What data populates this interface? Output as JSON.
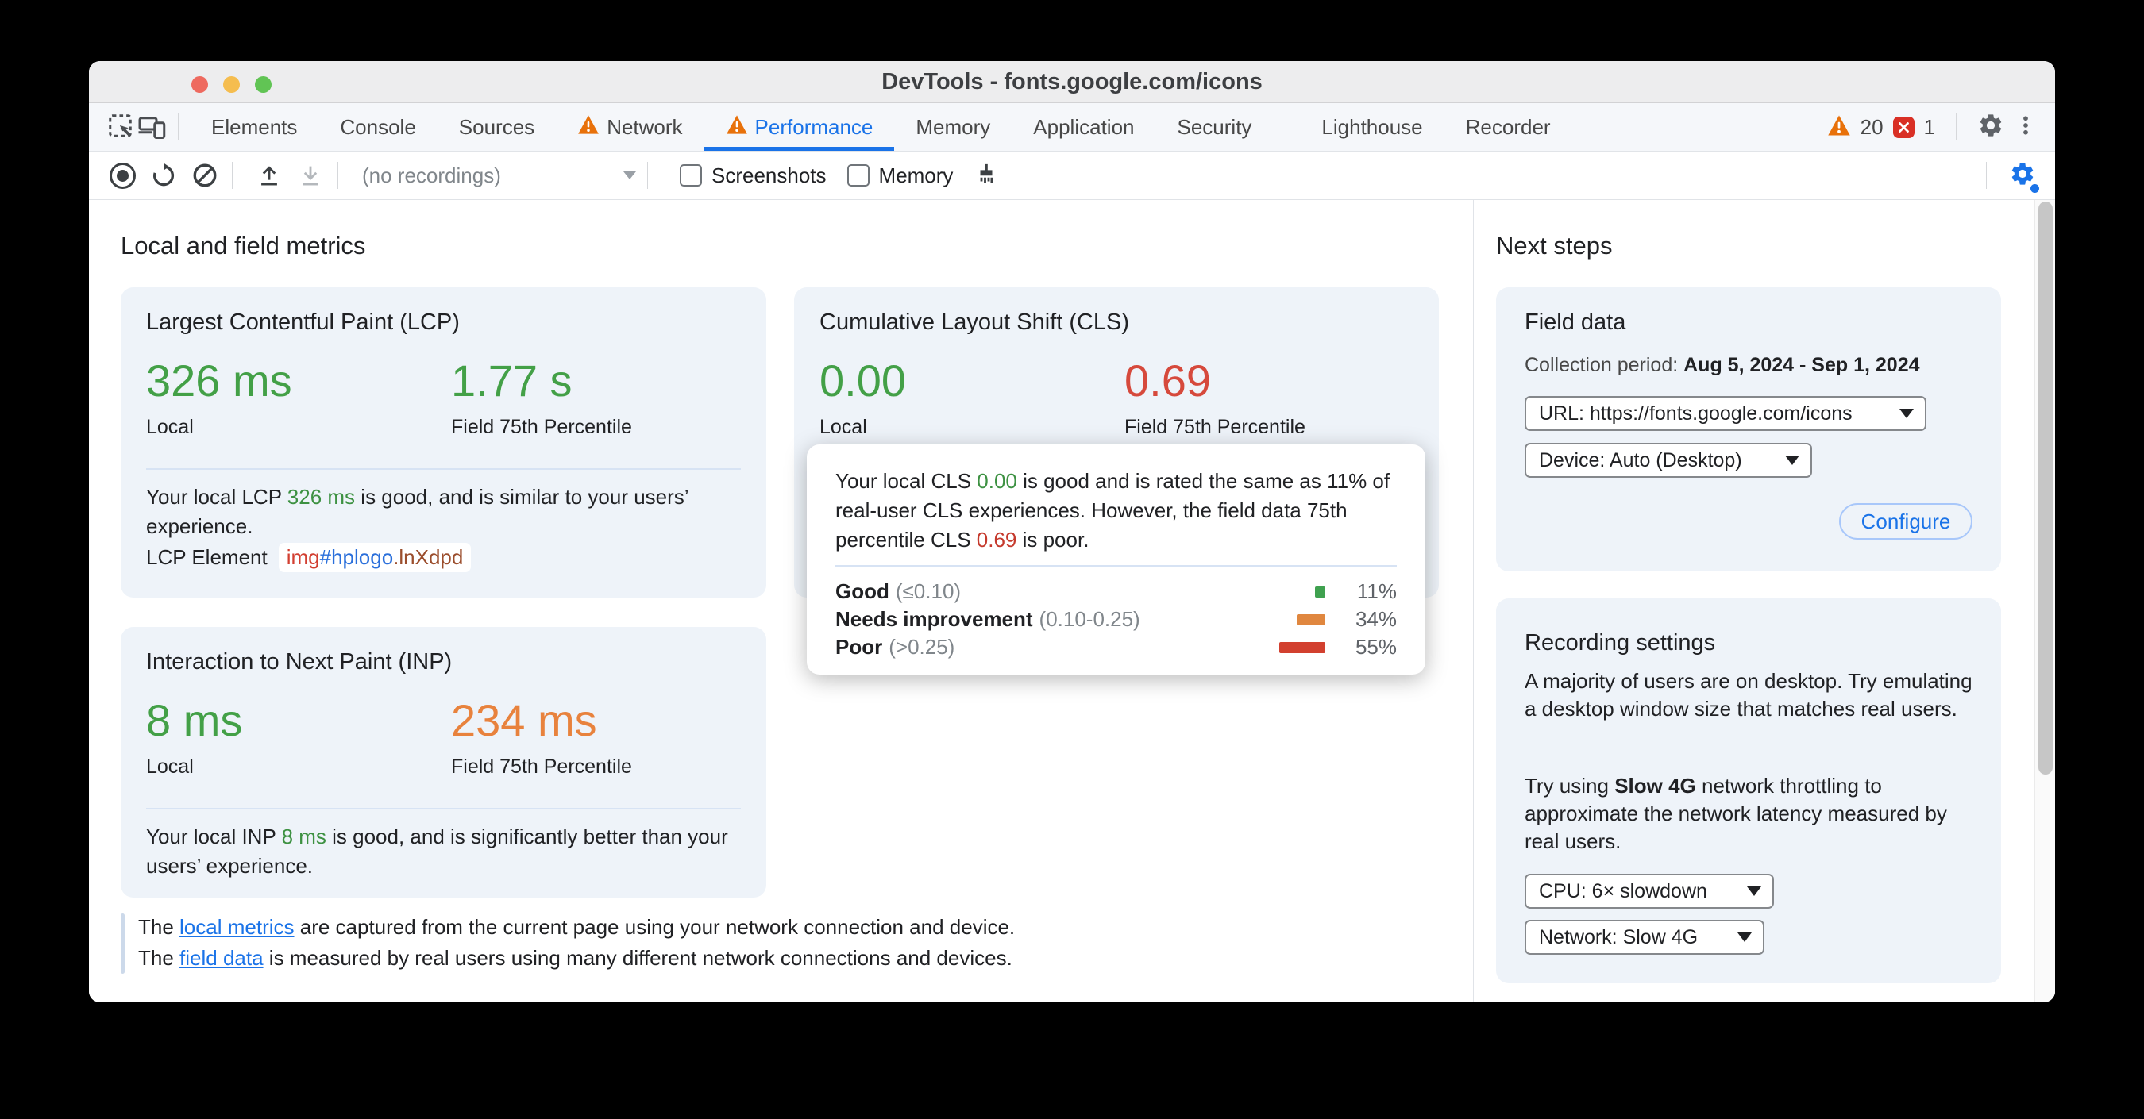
{
  "colors": {
    "accent_blue": "#1a73e8",
    "good_green": "#43a047",
    "poor_red": "#d6493c",
    "needs_improvement_orange": "#e8823d",
    "warning_orange": "#e8710a",
    "error_red": "#d93025",
    "card_bg": "#eef3f9"
  },
  "titlebar": {
    "title": "DevTools - fonts.google.com/icons"
  },
  "tabbar": {
    "tabs": [
      {
        "label": "Elements"
      },
      {
        "label": "Console"
      },
      {
        "label": "Sources"
      },
      {
        "label": "Network"
      },
      {
        "label": "Performance"
      },
      {
        "label": "Memory"
      },
      {
        "label": "Application"
      },
      {
        "label": "Security"
      },
      {
        "label": "Lighthouse"
      },
      {
        "label": "Recorder"
      }
    ],
    "warning_count": "20",
    "error_count": "1"
  },
  "toolbar": {
    "recordings": "(no recordings)",
    "screenshots": "Screenshots",
    "memory": "Memory"
  },
  "main": {
    "heading": "Local and field metrics",
    "lcp": {
      "title": "Largest Contentful Paint (LCP)",
      "local_value": "326 ms",
      "local_label": "Local",
      "field_value": "1.77 s",
      "field_label": "Field 75th Percentile",
      "desc_pre": "Your local LCP ",
      "desc_value": "326 ms",
      "desc_post": " is good, and is similar to your users’ experience.",
      "element_label": "LCP Element",
      "element_tag": "img",
      "element_id": "#hplogo",
      "element_class": ".lnXdpd"
    },
    "cls": {
      "title": "Cumulative Layout Shift (CLS)",
      "local_value": "0.00",
      "local_label": "Local",
      "field_value": "0.69",
      "field_label": "Field 75th Percentile"
    },
    "inp": {
      "title": "Interaction to Next Paint (INP)",
      "local_value": "8 ms",
      "local_label": "Local",
      "field_value": "234 ms",
      "field_label": "Field 75th Percentile",
      "desc_pre": "Your local INP ",
      "desc_value": "8 ms",
      "desc_post": " is good, and is significantly better than your users’ experience."
    },
    "tooltip": {
      "text_pre": "Your local CLS ",
      "text_good": "0.00",
      "text_mid": " is good and is rated the same as 11% of real-user CLS experiences. However, the field data 75th percentile CLS ",
      "text_poor": "0.69",
      "text_post": " is poor.",
      "rows": [
        {
          "label": "Good",
          "range": "(≤0.10)",
          "percent": "11%"
        },
        {
          "label": "Needs improvement",
          "range": "(0.10-0.25)",
          "percent": "34%"
        },
        {
          "label": "Poor",
          "range": "(>0.25)",
          "percent": "55%"
        }
      ]
    },
    "footer": {
      "line1_pre": "The ",
      "line1_link": "local metrics",
      "line1_post": " are captured from the current page using your network connection and device.",
      "line2_pre": "The ",
      "line2_link": "field data",
      "line2_post": " is measured by real users using many different network connections and devices."
    }
  },
  "sidebar": {
    "heading": "Next steps",
    "field_data": {
      "title": "Field data",
      "collection_label": "Collection period: ",
      "collection_value": "Aug 5, 2024 - Sep 1, 2024",
      "url_select": "URL: https://fonts.google.com/icons",
      "device_select": "Device: Auto (Desktop)",
      "configure": "Configure"
    },
    "recording": {
      "title": "Recording settings",
      "para1": "A majority of users are on desktop. Try emulating a desktop window size that matches real users.",
      "para2_pre": "Try using ",
      "para2_bold": "Slow 4G",
      "para2_post": " network throttling to approximate the network latency measured by real users.",
      "cpu_select": "CPU: 6× slowdown",
      "network_select": "Network: Slow 4G"
    }
  }
}
